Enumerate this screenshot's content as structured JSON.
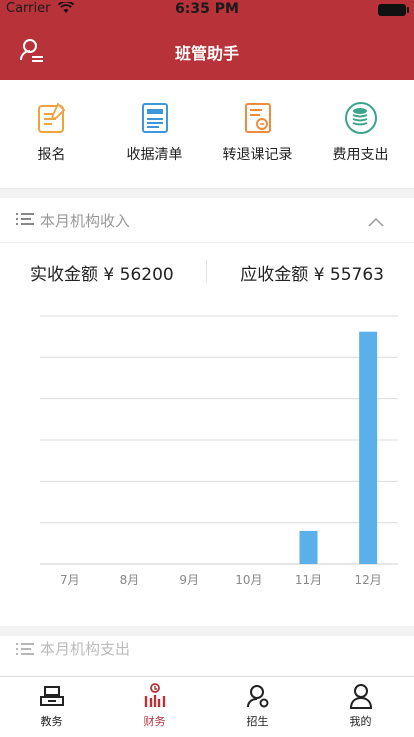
{
  "status_bar": {
    "carrier": "Carrier",
    "time": "6:35 PM"
  },
  "nav": {
    "title": "班管助手"
  },
  "quick_actions": [
    {
      "label": "报名",
      "icon": "signup-form-icon"
    },
    {
      "label": "收据清单",
      "icon": "receipt-list-icon"
    },
    {
      "label": "转退课记录",
      "icon": "transfer-record-icon"
    },
    {
      "label": "费用支出",
      "icon": "expense-coins-icon"
    }
  ],
  "income_card": {
    "title": "本月机构收入",
    "actual_label": "实收金额 ¥ 56200",
    "expected_label": "应收金额 ¥ 55763"
  },
  "chart_data": {
    "type": "bar",
    "categories": [
      "7月",
      "8月",
      "9月",
      "10月",
      "11月",
      "12月"
    ],
    "values": [
      0,
      0,
      0,
      0,
      8000,
      56200
    ],
    "ylim": [
      0,
      60000
    ],
    "grid": true,
    "bar_color": "#5bb0ea"
  },
  "expense_card": {
    "title": "本月机构支出"
  },
  "tabs": [
    {
      "label": "教务",
      "icon": "academic-icon"
    },
    {
      "label": "财务",
      "icon": "finance-chart-icon",
      "active": true
    },
    {
      "label": "招生",
      "icon": "enroll-user-icon"
    },
    {
      "label": "我的",
      "icon": "profile-icon"
    }
  ],
  "colors": {
    "brand": "#b8323a",
    "bar": "#5bb0ea"
  }
}
